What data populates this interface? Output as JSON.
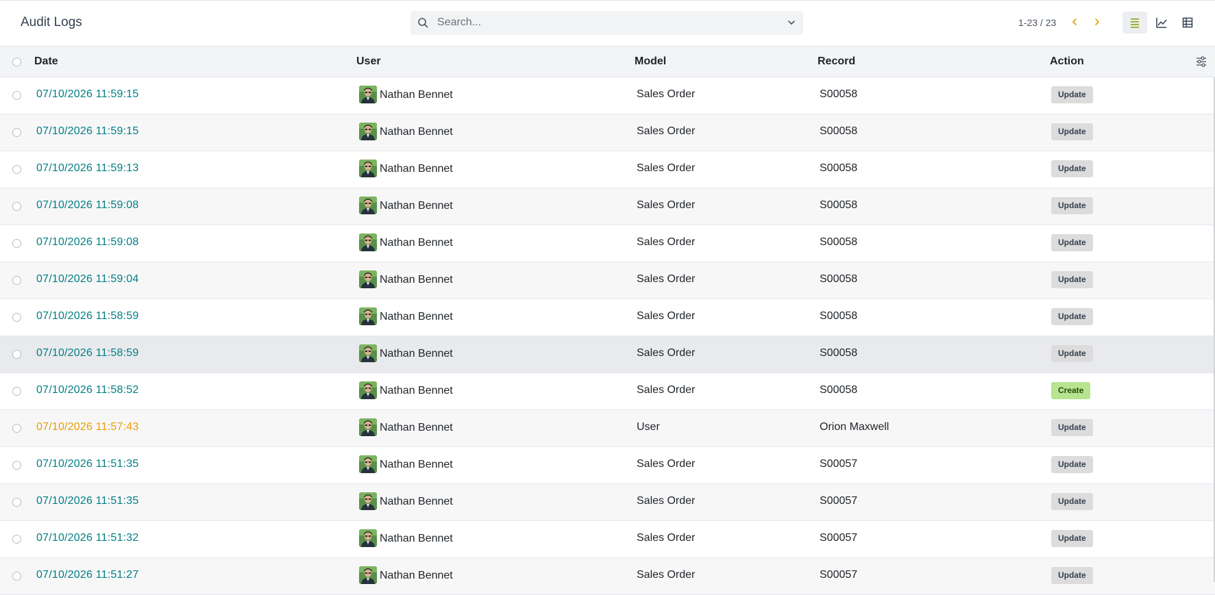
{
  "header": {
    "title": "Audit Logs",
    "search_placeholder": "Search...",
    "pager": "1-23 / 23"
  },
  "columns": {
    "date": "Date",
    "user": "User",
    "model": "Model",
    "record": "Record",
    "action": "Action"
  },
  "colors": {
    "link": "#017e84",
    "warning": "#e99d00",
    "create_badge": "#b7e48f",
    "update_badge": "#dcdcdc"
  },
  "rows": [
    {
      "date": "07/10/2026 11:59:15",
      "user": "Nathan Bennet",
      "model": "Sales Order",
      "record": "S00058",
      "action": "Update"
    },
    {
      "date": "07/10/2026 11:59:15",
      "user": "Nathan Bennet",
      "model": "Sales Order",
      "record": "S00058",
      "action": "Update"
    },
    {
      "date": "07/10/2026 11:59:13",
      "user": "Nathan Bennet",
      "model": "Sales Order",
      "record": "S00058",
      "action": "Update"
    },
    {
      "date": "07/10/2026 11:59:08",
      "user": "Nathan Bennet",
      "model": "Sales Order",
      "record": "S00058",
      "action": "Update"
    },
    {
      "date": "07/10/2026 11:59:08",
      "user": "Nathan Bennet",
      "model": "Sales Order",
      "record": "S00058",
      "action": "Update"
    },
    {
      "date": "07/10/2026 11:59:04",
      "user": "Nathan Bennet",
      "model": "Sales Order",
      "record": "S00058",
      "action": "Update"
    },
    {
      "date": "07/10/2026 11:58:59",
      "user": "Nathan Bennet",
      "model": "Sales Order",
      "record": "S00058",
      "action": "Update"
    },
    {
      "date": "07/10/2026 11:58:59",
      "user": "Nathan Bennet",
      "model": "Sales Order",
      "record": "S00058",
      "action": "Update"
    },
    {
      "date": "07/10/2026 11:58:52",
      "user": "Nathan Bennet",
      "model": "Sales Order",
      "record": "S00058",
      "action": "Create"
    },
    {
      "date": "07/10/2026 11:57:43",
      "user": "Nathan Bennet",
      "model": "User",
      "record": "Orion Maxwell",
      "action": "Update"
    },
    {
      "date": "07/10/2026 11:51:35",
      "user": "Nathan Bennet",
      "model": "Sales Order",
      "record": "S00057",
      "action": "Update"
    },
    {
      "date": "07/10/2026 11:51:35",
      "user": "Nathan Bennet",
      "model": "Sales Order",
      "record": "S00057",
      "action": "Update"
    },
    {
      "date": "07/10/2026 11:51:32",
      "user": "Nathan Bennet",
      "model": "Sales Order",
      "record": "S00057",
      "action": "Update"
    },
    {
      "date": "07/10/2026 11:51:27",
      "user": "Nathan Bennet",
      "model": "Sales Order",
      "record": "S00057",
      "action": "Update"
    }
  ]
}
